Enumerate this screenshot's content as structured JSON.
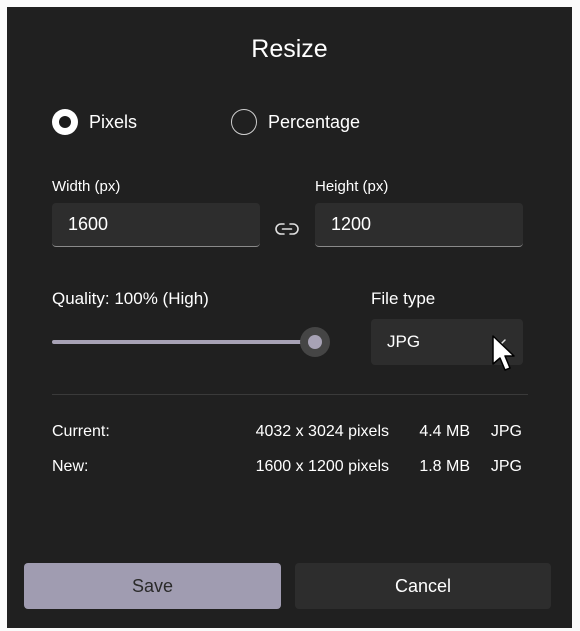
{
  "dialog": {
    "title": "Resize"
  },
  "mode": {
    "options": [
      {
        "label": "Pixels",
        "selected": true
      },
      {
        "label": "Percentage",
        "selected": false
      }
    ]
  },
  "dimensions": {
    "width_label": "Width (px)",
    "width_value": "1600",
    "height_label": "Height (px)",
    "height_value": "1200",
    "link_icon": "link-icon"
  },
  "quality": {
    "label": "Quality: 100% (High)",
    "value_percent": 100
  },
  "file_type": {
    "label": "File type",
    "selected": "JPG"
  },
  "info": {
    "current": {
      "label": "Current:",
      "dimensions": "4032 x 3024 pixels",
      "size": "4.4 MB",
      "format": "JPG"
    },
    "new": {
      "label": "New:",
      "dimensions": "1600 x 1200 pixels",
      "size": "1.8 MB",
      "format": "JPG"
    }
  },
  "buttons": {
    "save": "Save",
    "cancel": "Cancel"
  },
  "colors": {
    "background": "#202020",
    "accent": "#a09cb1",
    "input_bg": "#2d2d2d"
  }
}
